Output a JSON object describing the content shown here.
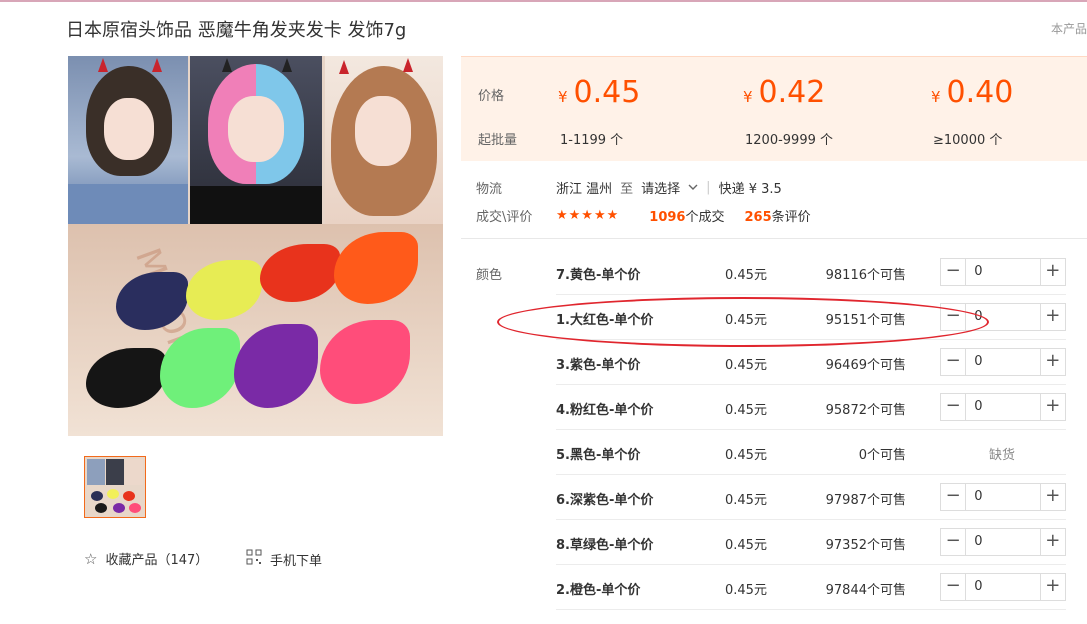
{
  "title": "日本原宿头饰品 恶魔牛角发夹发卡 发饰7g",
  "corner_note": "本产品",
  "gallery": {
    "main_image": "product photo: three models wearing devil horn hair clips and colorful horn clips",
    "brand_watermark": "MIRON"
  },
  "actions": {
    "favorite_icon": "star-outline-icon",
    "favorite_label": "收藏产品（147）",
    "mobile_icon": "qr-code-icon",
    "mobile_label": "手机下单"
  },
  "pricing": {
    "price_label": "价格",
    "min_batch_label": "起批量",
    "currency": "¥",
    "tiers": [
      {
        "price": "0.45",
        "qty": "1-1199 个"
      },
      {
        "price": "0.42",
        "qty": "1200-9999 个"
      },
      {
        "price": "0.40",
        "qty": "≥10000 个"
      }
    ]
  },
  "logistics": {
    "label": "物流",
    "origin": "浙江 温州",
    "to": "至",
    "dest": "请选择",
    "express": "快递 ¥ 3.5"
  },
  "reviews": {
    "label": "成交\\评价",
    "stars": "★★★★★",
    "deals_count": "1096",
    "deals_suffix": "个成交",
    "review_count": "265",
    "review_suffix": "条评价"
  },
  "color_label": "颜色",
  "skus": [
    {
      "name": "7.黄色-单个价",
      "price": "0.45元",
      "stock": "98116个可售",
      "qty": "0"
    },
    {
      "name": "1.大红色-单个价",
      "price": "0.45元",
      "stock": "95151个可售",
      "qty": "0"
    },
    {
      "name": "3.紫色-单个价",
      "price": "0.45元",
      "stock": "96469个可售",
      "qty": "0"
    },
    {
      "name": "4.粉红色-单个价",
      "price": "0.45元",
      "stock": "95872个可售",
      "qty": "0"
    },
    {
      "name": "5.黑色-单个价",
      "price": "0.45元",
      "stock": "0个可售",
      "status": "缺货"
    },
    {
      "name": "6.深紫色-单个价",
      "price": "0.45元",
      "stock": "97987个可售",
      "qty": "0"
    },
    {
      "name": "8.草绿色-单个价",
      "price": "0.45元",
      "stock": "97352个可售",
      "qty": "0"
    },
    {
      "name": "2.橙色-单个价",
      "price": "0.45元",
      "stock": "97844个可售",
      "qty": "0"
    }
  ],
  "colors": {
    "accent": "#ff5000",
    "price_panel_bg": "#fff2e8",
    "annotation_circle": "#e0262e"
  }
}
